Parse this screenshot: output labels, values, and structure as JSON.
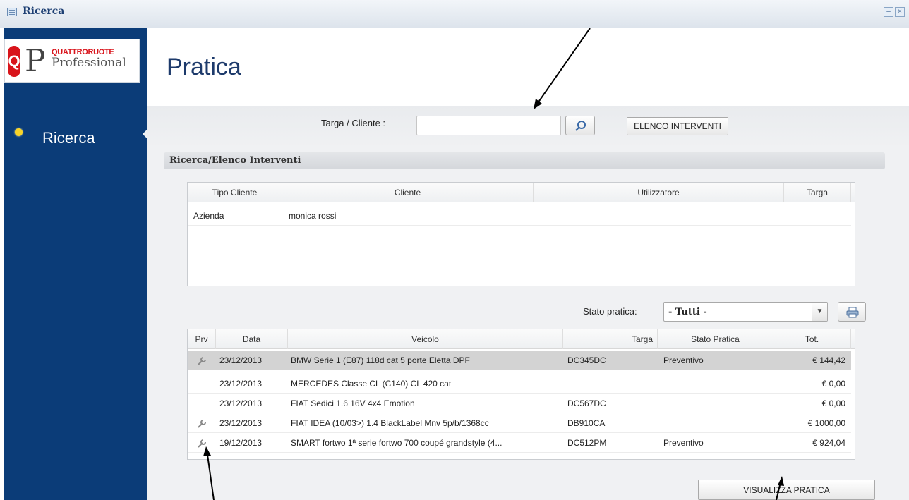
{
  "window": {
    "title": "Ricerca",
    "min_icon": "minimize-icon",
    "close_icon": "close-icon"
  },
  "logo": {
    "brand": "QUATTRORUOTE",
    "sub": "Professional",
    "letter_q": "Q",
    "letter_p": "P"
  },
  "sidebar": {
    "items": [
      {
        "label": "Ricerca",
        "active": true
      }
    ]
  },
  "page": {
    "title": "Pratica"
  },
  "search": {
    "label": "Targa / Cliente :",
    "value": "",
    "placeholder": "",
    "button_icon": "search-icon",
    "elenco_label": "ELENCO INTERVENTI"
  },
  "section": {
    "title": "Ricerca/Elenco Interventi"
  },
  "clients_table": {
    "headers": [
      "Tipo Cliente",
      "Cliente",
      "Utilizzatore",
      "Targa"
    ],
    "rows": [
      {
        "tipo": "Azienda",
        "cliente": "monica rossi",
        "utilizzatore": "",
        "targa": ""
      }
    ]
  },
  "filter": {
    "label": "Stato pratica:",
    "selected": "- Tutti -",
    "print_icon": "printer-icon"
  },
  "practices_table": {
    "headers": [
      "Prv",
      "Data",
      "Veicolo",
      "Targa",
      "Stato Pratica",
      "Tot."
    ],
    "rows": [
      {
        "prv": true,
        "data": "23/12/2013",
        "veicolo": "BMW Serie 1 (E87) 118d cat 5 porte Eletta DPF",
        "targa": "DC345DC",
        "stato": "Preventivo",
        "tot": "€ 144,42"
      },
      {
        "prv": false,
        "data": "23/12/2013",
        "veicolo": "MERCEDES Classe CL (C140) CL 420 cat",
        "targa": "",
        "stato": "",
        "tot": "€ 0,00"
      },
      {
        "prv": false,
        "data": "23/12/2013",
        "veicolo": "FIAT Sedici 1.6 16V 4x4 Emotion",
        "targa": "DC567DC",
        "stato": "",
        "tot": "€ 0,00"
      },
      {
        "prv": true,
        "data": "23/12/2013",
        "veicolo": "FIAT IDEA (10/03>) 1.4 BlackLabel Mnv 5p/b/1368cc",
        "targa": "DB910CA",
        "stato": "",
        "tot": "€ 1000,00"
      },
      {
        "prv": true,
        "data": "19/12/2013",
        "veicolo": "SMART fortwo 1ª serie fortwo 700 coupé grandstyle (4...",
        "targa": "DC512PM",
        "stato": "Preventivo",
        "tot": "€ 924,04"
      }
    ]
  },
  "actions": {
    "visualizza_label": "VISUALIZZA PRATICA"
  },
  "colors": {
    "sidebar": "#0b3c78",
    "title": "#1d3a6b",
    "accent_dot": "#f8d428",
    "selected_row": "#d3d3d3"
  }
}
